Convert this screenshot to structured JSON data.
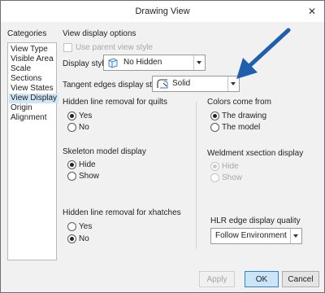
{
  "window": {
    "title": "Drawing View"
  },
  "categories": {
    "heading": "Categories",
    "items": [
      "View Type",
      "Visible Area",
      "Scale",
      "Sections",
      "View States",
      "View Display",
      "Origin",
      "Alignment"
    ],
    "selected_index": 5
  },
  "view_display": {
    "heading": "View display options",
    "use_parent_label": "Use parent view style",
    "display_style": {
      "label": "Display style",
      "value": "No Hidden"
    },
    "tangent_edges": {
      "label": "Tangent edges display style",
      "value": "Solid"
    },
    "hidden_line_quilts": {
      "label": "Hidden line removal for quilts",
      "options": [
        "Yes",
        "No"
      ],
      "selected": "Yes"
    },
    "skeleton": {
      "label": "Skeleton model display",
      "options": [
        "Hide",
        "Show"
      ],
      "selected": "Hide"
    },
    "hidden_line_xhatches": {
      "label": "Hidden line removal for xhatches",
      "options": [
        "Yes",
        "No"
      ],
      "selected": "No"
    },
    "colors_come_from": {
      "label": "Colors come from",
      "options": [
        "The drawing",
        "The model"
      ],
      "selected": "The drawing"
    },
    "weldment": {
      "label": "Weldment xsection display",
      "options": [
        "Hide",
        "Show"
      ],
      "selected": "Hide"
    },
    "hlr_quality": {
      "label": "HLR edge display quality",
      "value": "Follow Environment"
    }
  },
  "buttons": {
    "apply": "Apply",
    "ok": "OK",
    "cancel": "Cancel"
  },
  "colors": {
    "arrow": "#1f5fae",
    "accent_border": "#2f82d5",
    "selection": "#cfe6f7"
  }
}
